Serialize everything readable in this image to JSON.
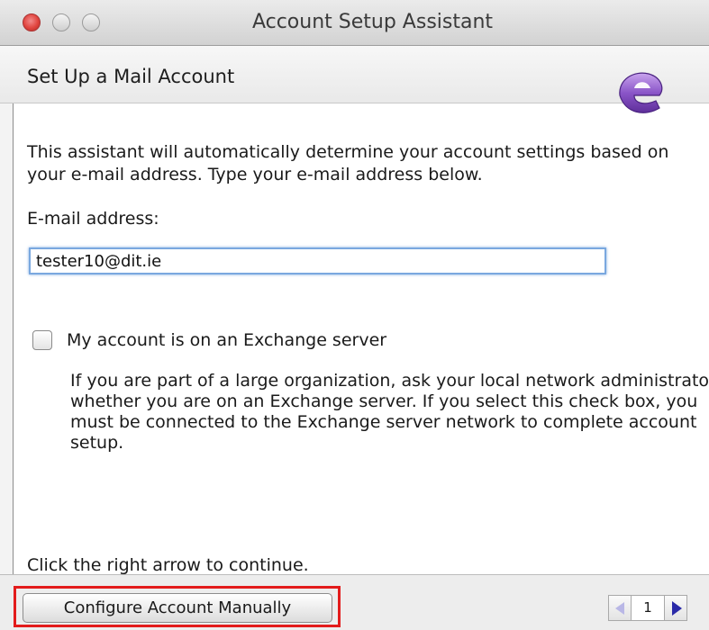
{
  "window": {
    "title": "Account Setup Assistant",
    "header": "Set Up a Mail Account"
  },
  "intro": {
    "text": "This assistant will automatically determine your account settings based on your e-mail address. Type your e-mail address below."
  },
  "email": {
    "label": "E-mail address:",
    "value": "tester10@dit.ie"
  },
  "exchange": {
    "checkbox_label": "My account is on an Exchange server",
    "checked": false,
    "description": "If you are part of a large organization, ask your local network administrator whether you are on an Exchange server. If you select this check box, you must be connected to the Exchange server network to complete account setup."
  },
  "footer": {
    "continue_text": "Click the right arrow to continue.",
    "configure_button": "Configure Account Manually",
    "page_number": "1"
  },
  "colors": {
    "highlight": "#e31b1b",
    "logo_purple": "#8a55c8",
    "next_arrow": "#2a2aa8",
    "prev_arrow_disabled": "#b9b7e6"
  },
  "icons": {
    "close": "close-traffic-light-icon",
    "minimize": "minimize-traffic-light-icon",
    "zoom": "zoom-traffic-light-icon",
    "logo": "entourage-logo-icon",
    "prev": "left-arrow-icon",
    "next": "right-arrow-icon"
  }
}
